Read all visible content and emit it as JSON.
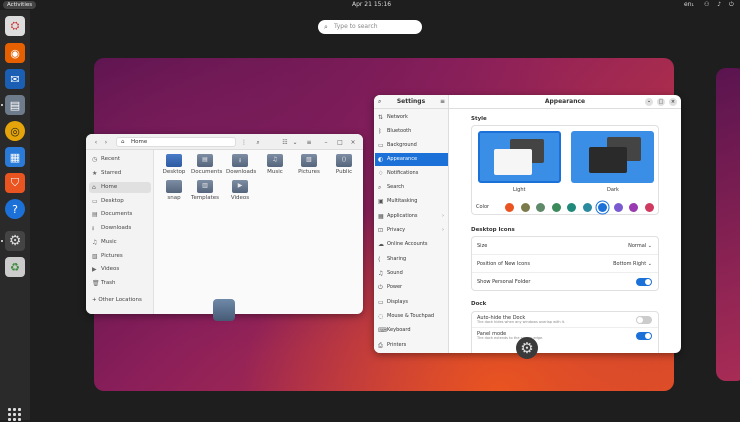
{
  "topbar": {
    "activities": "Activities",
    "clock": "Apr 21  15:16",
    "lang": "en₁",
    "tray": "⚇ ♪ ⏻"
  },
  "search": {
    "placeholder": "Type to search"
  },
  "files": {
    "path": "Home",
    "sidebar": [
      "Recent",
      "Starred",
      "Home",
      "Desktop",
      "Documents",
      "Downloads",
      "Music",
      "Pictures",
      "Videos",
      "Trash"
    ],
    "other": "+  Other Locations",
    "folders": [
      "Desktop",
      "Documents",
      "Downloads",
      "Music",
      "Pictures",
      "Public",
      "snap",
      "Templates",
      "Videos"
    ]
  },
  "settings": {
    "title": "Settings",
    "page": "Appearance",
    "nav": [
      "Network",
      "Bluetooth",
      "Background",
      "Appearance",
      "Notifications",
      "Search",
      "Multitasking",
      "Applications",
      "Privacy",
      "Online Accounts",
      "Sharing",
      "Sound",
      "Power",
      "Displays",
      "Mouse & Touchpad",
      "Keyboard",
      "Printers"
    ],
    "style_label": "Style",
    "light": "Light",
    "dark": "Dark",
    "color_label": "Color",
    "colors": [
      "#e95420",
      "#7a7a4a",
      "#5f8a6a",
      "#3a8a5a",
      "#1f8a7a",
      "#2a8aa0",
      "#1c71d8",
      "#7a5ad0",
      "#9a3ab0",
      "#d03a60"
    ],
    "desktop_icons": "Desktop Icons",
    "size_label": "Size",
    "size_val": "Normal ⌄",
    "pos_label": "Position of New Icons",
    "pos_val": "Bottom Right ⌄",
    "personal": "Show Personal Folder",
    "dock": "Dock",
    "autohide": "Auto-hide the Dock",
    "autohide_sub": "The dock hides when any windows overlap with it.",
    "panel": "Panel mode",
    "panel_sub": "The dock extends to the screen edge."
  }
}
